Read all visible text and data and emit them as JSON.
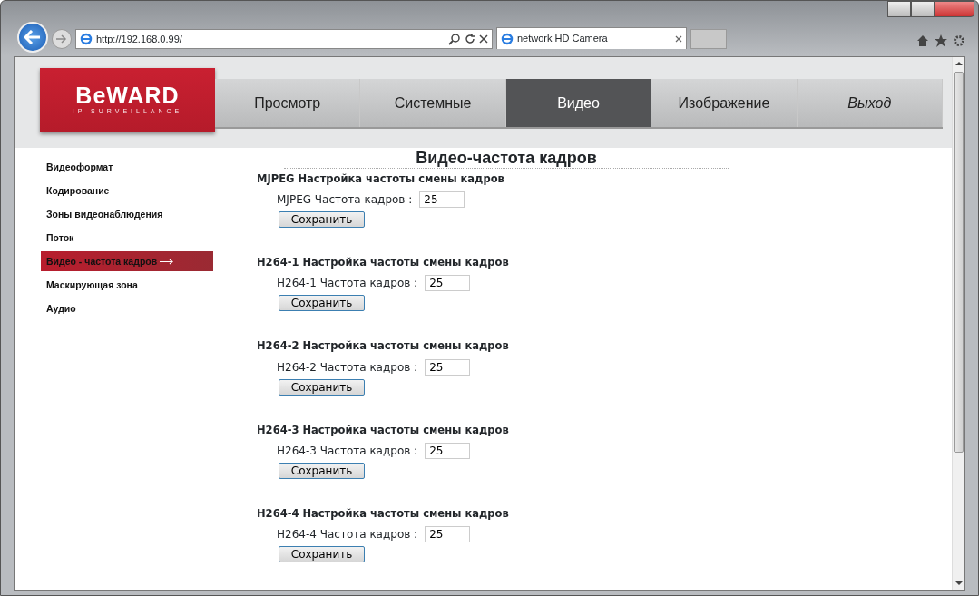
{
  "browser": {
    "address": "http://192.168.0.99/",
    "tabs": [
      {
        "label": "network HD Camera",
        "selected": true
      }
    ]
  },
  "logo": {
    "name": "BeWARD",
    "tagline": "IP SURVEILLANCE"
  },
  "nav": [
    {
      "label": "Просмотр",
      "selected": false,
      "italic": false
    },
    {
      "label": "Системные",
      "selected": false,
      "italic": false
    },
    {
      "label": "Видео",
      "selected": true,
      "italic": false
    },
    {
      "label": "Изображение",
      "selected": false,
      "italic": false
    },
    {
      "label": "Выход",
      "selected": false,
      "italic": true
    }
  ],
  "sidebar": [
    {
      "label": "Видеоформат",
      "selected": false
    },
    {
      "label": "Кодирование",
      "selected": false
    },
    {
      "label": "Зоны видеонаблюдения",
      "selected": false
    },
    {
      "label": "Поток",
      "selected": false
    },
    {
      "label": "Видео - частота кадров",
      "selected": true
    },
    {
      "label": "Маскирующая зона",
      "selected": false
    },
    {
      "label": "Аудио",
      "selected": false
    }
  ],
  "title": "Видео-частота кадров",
  "sections": [
    {
      "heading": "MJPEG Настройка частоты смены кадров",
      "label": "MJPEG Частота кадров :",
      "value": "25",
      "button": "Сохранить"
    },
    {
      "heading": "H264-1 Настройка частоты смены кадров",
      "label": "H264-1 Частота кадров :",
      "value": "25",
      "button": "Сохранить"
    },
    {
      "heading": "H264-2 Настройка частоты смены кадров",
      "label": "H264-2 Частота кадров :",
      "value": "25",
      "button": "Сохранить"
    },
    {
      "heading": "H264-3 Настройка частоты смены кадров",
      "label": "H264-3 Частота кадров :",
      "value": "25",
      "button": "Сохранить"
    },
    {
      "heading": "H264-4 Настройка частоты смены кадров",
      "label": "H264-4 Частота кадров :",
      "value": "25",
      "button": "Сохранить"
    }
  ]
}
